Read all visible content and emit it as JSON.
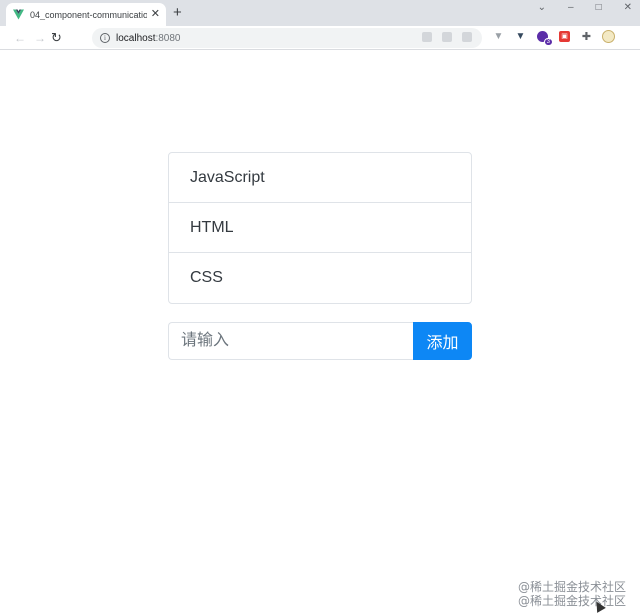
{
  "browser": {
    "tab_title": "04_component-communicatio",
    "tab_close": "✕",
    "new_tab": "+",
    "url_host": "localhost",
    "url_port": ":8080",
    "extension_badge": "3",
    "accent_color": "#0d87f5"
  },
  "icons": [
    "vue-favicon-icon",
    "info-icon",
    "reload-icon",
    "back-icon",
    "forward-icon",
    "extensions-puzzle-icon",
    "profile-avatar-icon"
  ],
  "list": {
    "items": [
      "JavaScript",
      "HTML",
      "CSS"
    ]
  },
  "form": {
    "placeholder": "请输入",
    "value": "",
    "add_label": "添加"
  },
  "watermark": {
    "line1": "@稀土掘金技术社区",
    "line2": "@稀土掘金技术社区"
  }
}
